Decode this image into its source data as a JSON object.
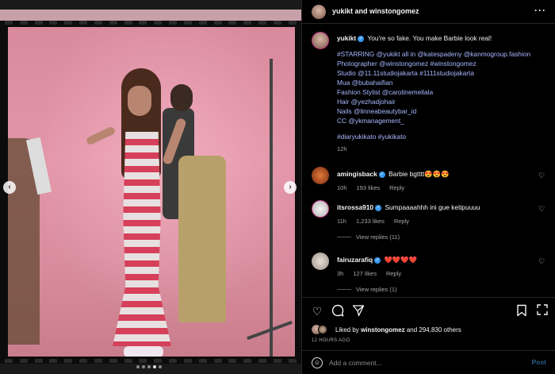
{
  "media": {
    "nav_prev": "‹",
    "nav_next": "›",
    "carousel_total": 5,
    "carousel_active": 4
  },
  "header": {
    "title": "yukikt and winstongomez",
    "more_icon": "more-icon"
  },
  "caption": {
    "username": "yukikt",
    "text": "You're so fake. You make Barbie look real!",
    "lines": [
      "#STARRING @yukikt all in @katespadeny @kanmogroup.fashion",
      "Photographer @winstongomez #winstongomez",
      "Studio @11.11studiojakarta #1111studiojakarta",
      "Mua @bubahaifian",
      "Fashion Stylist @carolinemellala",
      "Hair @yezhadjohair",
      "Nails @linneabeautybar_id",
      "CC @ykmanagement_"
    ],
    "tags": "#diaryukikato #yukikato",
    "time": "12h"
  },
  "comments": [
    {
      "username": "amingisback",
      "text": "Barbie bgtttt😍😍😍",
      "time": "10h",
      "likes": "193 likes",
      "reply": "Reply"
    },
    {
      "username": "itsrossa910",
      "text": "Sumpaaaahhh ini gue ketipuuuu",
      "time": "11h",
      "likes": "1,233 likes",
      "reply": "Reply",
      "view_replies": "View replies (11)"
    },
    {
      "username": "fairuzarafiq",
      "text": "❤️❤️❤️❤️",
      "time": "3h",
      "likes": "127 likes",
      "reply": "Reply",
      "view_replies": "View replies (1)"
    }
  ],
  "likes": {
    "prefix": "Liked by",
    "user": "winstongomez",
    "rest": "and 294,830 others"
  },
  "timestamp": "12 HOURS AGO",
  "add_comment": {
    "placeholder": "Add a comment...",
    "post_label": "Post"
  },
  "colors": {
    "background": "#000000",
    "verified": "#3897f0",
    "mention": "#a8b8ff",
    "post_disabled": "#2a5c8a"
  }
}
